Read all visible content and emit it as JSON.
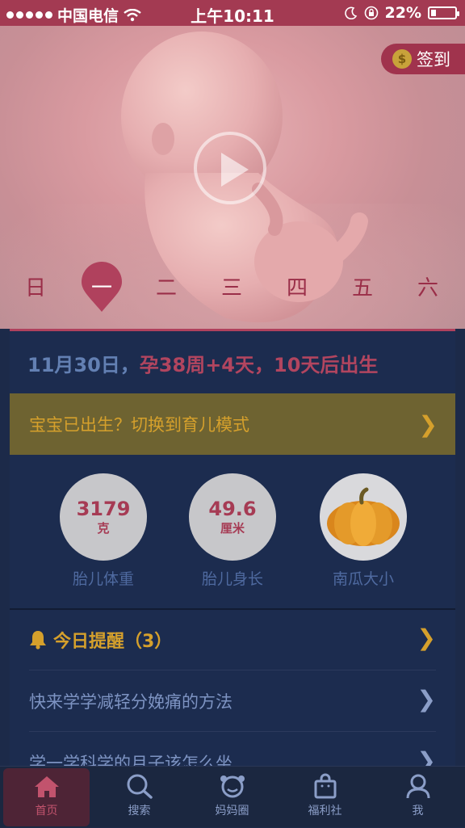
{
  "status_bar": {
    "carrier": "中国电信",
    "time": "上午10:11",
    "battery": "22%",
    "battery_level": 0.22
  },
  "hero": {
    "signin_label": "签到",
    "coin_symbol": "$",
    "week_days": [
      "日",
      "一",
      "二",
      "三",
      "四",
      "五",
      "六"
    ],
    "active_day_index": 1
  },
  "info": {
    "date_text": "11月30日，",
    "pregnancy_text": "孕38周+4天，10天后出生",
    "switch_label": "宝宝已出生？切换到育儿模式",
    "stats": [
      {
        "value": "3179",
        "unit": "克",
        "label": "胎儿体重"
      },
      {
        "value": "49.6",
        "unit": "厘米",
        "label": "胎儿身长"
      },
      {
        "value": "",
        "unit": "",
        "label": "南瓜大小"
      }
    ]
  },
  "reminders": {
    "title": "今日提醒（3）",
    "items": [
      "快来学学减轻分娩痛的方法",
      "学一学科学的月子该怎么坐"
    ]
  },
  "tabs": [
    {
      "label": "首页",
      "icon": "home-icon"
    },
    {
      "label": "搜索",
      "icon": "search-icon"
    },
    {
      "label": "妈妈圈",
      "icon": "circle-community-icon"
    },
    {
      "label": "福利社",
      "icon": "shopping-bag-icon"
    },
    {
      "label": "我",
      "icon": "person-icon"
    }
  ],
  "colors": {
    "accent": "#b0415d",
    "gold": "#d5a02c",
    "card_bg": "#1c2c4f",
    "status_bar": "#a33a52"
  }
}
